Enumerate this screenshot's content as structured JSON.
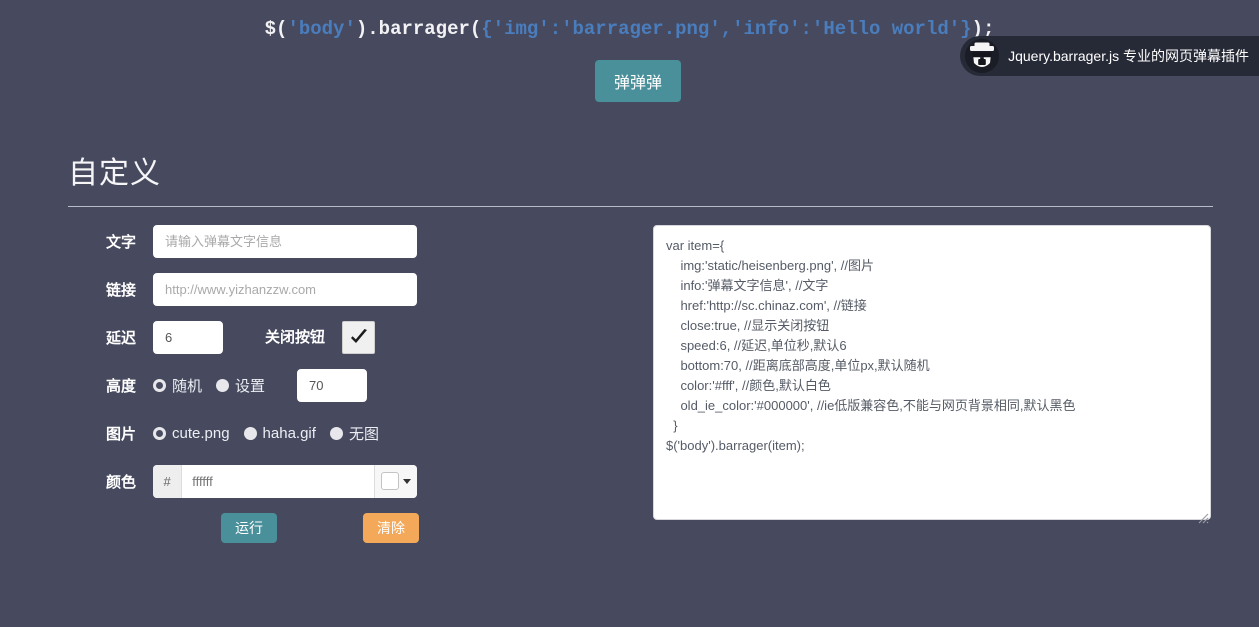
{
  "page": {
    "background_color": "#474a5e",
    "code_title_parts": [
      {
        "text": "$(",
        "style": "white"
      },
      {
        "text": "'body'",
        "style": "blue"
      },
      {
        "text": ").barrager(",
        "style": "white"
      },
      {
        "text": "{'img':'barrager.png','info':'Hello world'}",
        "style": "blue"
      },
      {
        "text": ");",
        "style": "white"
      }
    ],
    "code_title_plain": "$('body').barrager({'img':'barrager.png','info':'Hello world'});",
    "accent_teal": "#49909b",
    "accent_orange": "#f4a95a",
    "code_string_blue": "#4a7dbd"
  },
  "barrager": {
    "text": "Jquery.barrager.js 专业的网页弹幕插件",
    "avatar_icon": "heisenberg-avatar-image",
    "background_color": "#262936"
  },
  "toolbar": {
    "play_label": "弹弹弹"
  },
  "custom": {
    "section_title": "自定义",
    "labels": {
      "text": "文字",
      "link": "链接",
      "delay": "延迟",
      "close_button": "关闭按钮",
      "height": "高度",
      "image": "图片",
      "color": "颜色"
    },
    "text_field": {
      "value": "",
      "placeholder": "请输入弹幕文字信息"
    },
    "link_field": {
      "value": "",
      "placeholder": "http://www.yizhanzzw.com"
    },
    "delay_field": {
      "value": "6",
      "placeholder": ""
    },
    "close_checkbox": {
      "checked": true,
      "icon": "check-icon"
    },
    "height_options": [
      {
        "label": "随机",
        "selected": true
      },
      {
        "label": "设置",
        "selected": false
      }
    ],
    "height_field": {
      "value": "70",
      "placeholder": ""
    },
    "image_options": [
      {
        "label": "cute.png",
        "selected": true
      },
      {
        "label": "haha.gif",
        "selected": false
      },
      {
        "label": "无图",
        "selected": false
      }
    ],
    "color_field": {
      "prefix": "#",
      "value": "",
      "placeholder": "ffffff",
      "swatch_color": "#ffffff"
    },
    "run_label": "运行",
    "clear_label": "清除"
  },
  "code_editor": {
    "content": "var item={\n    img:'static/heisenberg.png', //图片\n    info:'弹幕文字信息', //文字\n    href:'http://sc.chinaz.com', //链接\n    close:true, //显示关闭按钮\n    speed:6, //延迟,单位秒,默认6\n    bottom:70, //距离底部高度,单位px,默认随机\n    color:'#fff', //颜色,默认白色\n    old_ie_color:'#000000', //ie低版兼容色,不能与网页背景相同,默认黑色\n  }\n$('body').barrager(item);"
  }
}
